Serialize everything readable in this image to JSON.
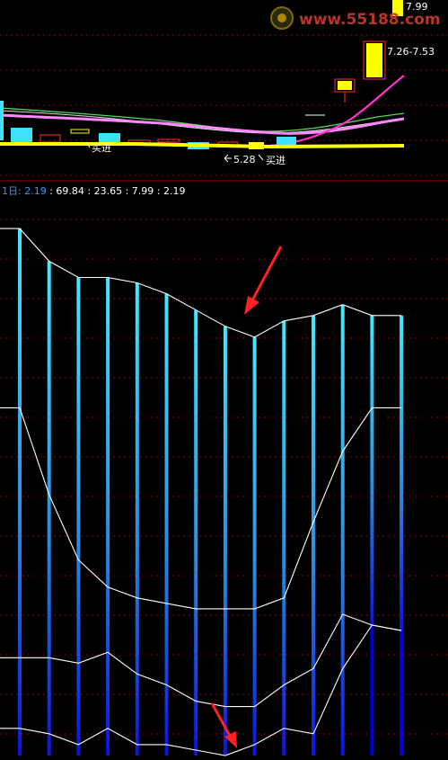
{
  "watermark": {
    "text": "www.55188.com"
  },
  "colors": {
    "background": "#000000",
    "grid": "#8b0000",
    "divider": "#a00000",
    "candle_up": "#ffff00",
    "candle_body_cyan": "#40e0ff",
    "candle_outline_red": "#ff3030",
    "ma_magenta": "#ff33cc",
    "ma_pink": "#ff88ff",
    "ma_green": "#55dd55",
    "ma_white": "#dddddd",
    "base_yellow": "#ffff00",
    "arrow": "#ff2020",
    "label_white": "#ffffff",
    "indicator_title_blue": "#3399ff",
    "line_white": "#ffffff",
    "bar_top": "#44e8ff",
    "bar_bottom": "#0000dd"
  },
  "price_panel": {
    "labels": {
      "high_price": "7.99",
      "range": "7.26-7.53",
      "low_price": "5.28",
      "buy_1": "买进",
      "buy_2": "买进"
    }
  },
  "indicator_panel": {
    "title_prefix": "1日: 2.19",
    "values_text": ": 69.84 : 23.65 : 7.99 : 2.19"
  },
  "chart_data": {
    "type": "bar",
    "bars": {
      "count": 14,
      "top_values": [
        97,
        91,
        88,
        88,
        87,
        85,
        82,
        79,
        77,
        80,
        81,
        83,
        81,
        81
      ],
      "gradient_break_values": [
        null,
        null,
        null,
        null,
        null,
        null,
        null,
        null,
        null,
        null,
        null,
        null,
        24,
        23
      ]
    },
    "lines": [
      {
        "values": [
          97,
          91,
          88,
          88,
          87,
          85,
          82,
          79,
          77,
          80,
          81,
          83,
          81,
          81
        ]
      },
      {
        "values": [
          64,
          48,
          36,
          31,
          29,
          28,
          27,
          27,
          27,
          29,
          43,
          56,
          64,
          64
        ]
      },
      {
        "values": [
          18,
          18,
          17,
          19,
          15,
          13,
          10,
          9,
          9,
          13,
          16,
          26,
          24,
          23
        ]
      },
      {
        "values": [
          5,
          4,
          2,
          5,
          2,
          2,
          1,
          0,
          2,
          5,
          4,
          16,
          24,
          23
        ]
      }
    ],
    "ylim": [
      0,
      100
    ],
    "grid": true
  }
}
